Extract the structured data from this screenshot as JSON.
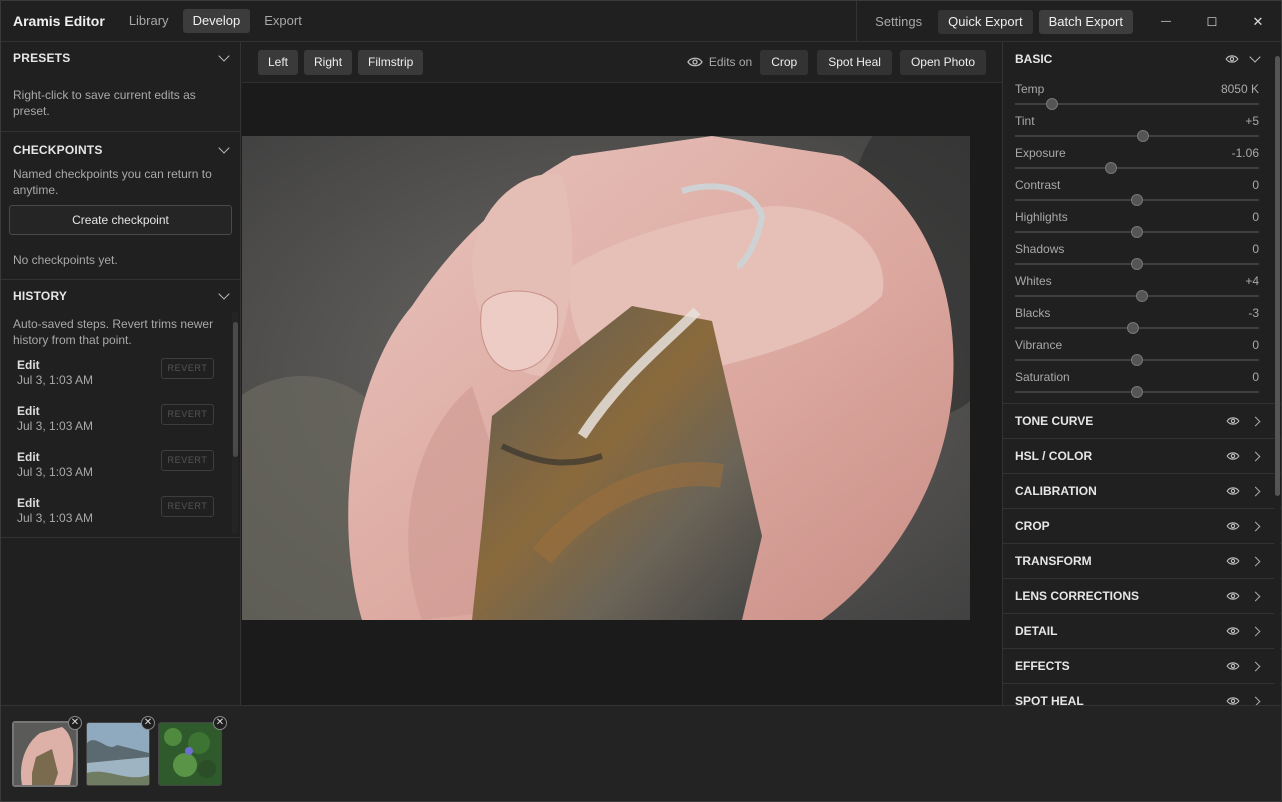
{
  "app": {
    "title": "Aramis Editor"
  },
  "nav": {
    "tabs": [
      "Library",
      "Develop",
      "Export"
    ],
    "active": "Develop"
  },
  "titlebar": {
    "settings": "Settings",
    "quick_export": "Quick Export",
    "batch_export": "Batch Export"
  },
  "presets": {
    "title": "PRESETS",
    "hint": "Right-click to save current edits as preset."
  },
  "checkpoints": {
    "title": "CHECKPOINTS",
    "hint": "Named checkpoints you can return to anytime.",
    "create_label": "Create checkpoint",
    "empty": "No checkpoints yet."
  },
  "history": {
    "title": "HISTORY",
    "hint": "Auto-saved steps. Revert trims newer history from that point.",
    "items": [
      {
        "name": "Edit",
        "time": "Jul 3, 1:03 AM",
        "action": "REVERT"
      },
      {
        "name": "Edit",
        "time": "Jul 3, 1:03 AM",
        "action": "REVERT"
      },
      {
        "name": "Edit",
        "time": "Jul 3, 1:03 AM",
        "action": "REVERT"
      },
      {
        "name": "Edit",
        "time": "Jul 3, 1:03 AM",
        "action": "REVERT"
      }
    ]
  },
  "toolbar": {
    "left": "Left",
    "right": "Right",
    "filmstrip": "Filmstrip",
    "edits_on": "Edits on",
    "crop": "Crop",
    "spot_heal": "Spot Heal",
    "open_photo": "Open Photo"
  },
  "basic": {
    "title": "BASIC",
    "sliders": [
      {
        "label": "Temp",
        "value": "8050 K",
        "level": 0.15
      },
      {
        "label": "Tint",
        "value": "+5",
        "level": 0.525
      },
      {
        "label": "Exposure",
        "value": "-1.06",
        "level": 0.394
      },
      {
        "label": "Contrast",
        "value": "0",
        "level": 0.5
      },
      {
        "label": "Highlights",
        "value": "0",
        "level": 0.5
      },
      {
        "label": "Shadows",
        "value": "0",
        "level": 0.5
      },
      {
        "label": "Whites",
        "value": "+4",
        "level": 0.52
      },
      {
        "label": "Blacks",
        "value": "-3",
        "level": 0.485
      },
      {
        "label": "Vibrance",
        "value": "0",
        "level": 0.5
      },
      {
        "label": "Saturation",
        "value": "0",
        "level": 0.5
      }
    ]
  },
  "panels": [
    "TONE CURVE",
    "HSL / COLOR",
    "CALIBRATION",
    "CROP",
    "TRANSFORM",
    "LENS CORRECTIONS",
    "DETAIL",
    "EFFECTS",
    "SPOT HEAL"
  ],
  "filmstrip": {
    "remove_glyph": "✕"
  },
  "window": {
    "minimize": "—",
    "maximize": "☐",
    "close": "✕"
  }
}
